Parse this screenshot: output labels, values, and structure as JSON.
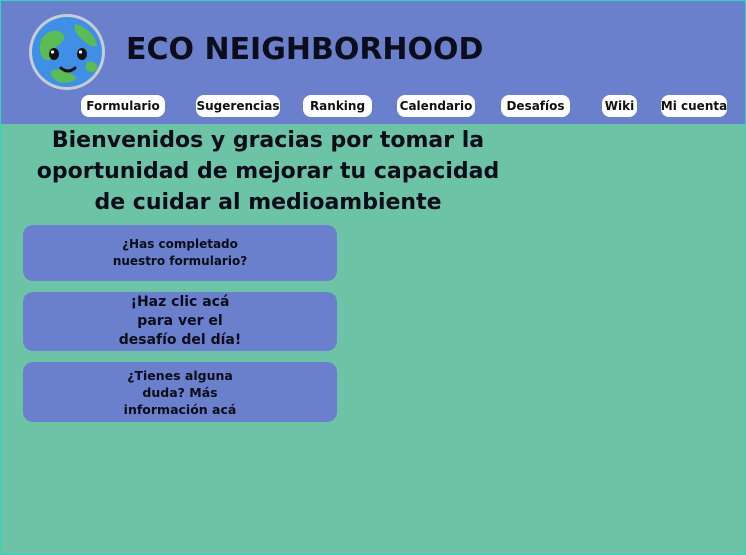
{
  "site": {
    "title": "ECO NEIGHBORHOOD",
    "logo_icon": "earth-smiley-icon"
  },
  "nav": {
    "items": [
      {
        "label": "Formulario"
      },
      {
        "label": "Sugerencias"
      },
      {
        "label": "Ranking"
      },
      {
        "label": "Calendario"
      },
      {
        "label": "Desafíos"
      },
      {
        "label": "Wiki"
      },
      {
        "label": "Mi cuenta"
      }
    ]
  },
  "main": {
    "welcome": "Bienvenidos y gracias por tomar la oportunidad de mejorar tu capacidad de cuidar al medioambiente",
    "cards": [
      {
        "lines": [
          "¿Has completado",
          "nuestro formulario?"
        ]
      },
      {
        "lines": [
          "¡Haz clic acá",
          "para ver el",
          "desafío del día!"
        ]
      },
      {
        "lines": [
          "¿Tienes alguna",
          "duda? Más",
          "información acá"
        ]
      }
    ]
  },
  "colors": {
    "header_bg": "#6a80cc",
    "page_bg": "#6dc3a5",
    "card_bg": "#6a80cc",
    "nav_btn_bg": "#ffffff"
  }
}
